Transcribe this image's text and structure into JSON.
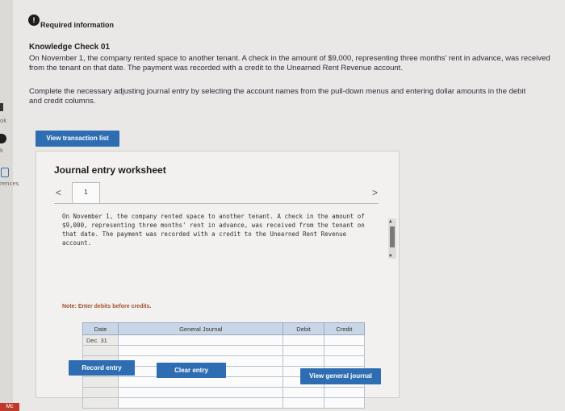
{
  "sidebar": {
    "labels": [
      "ok",
      "k",
      "rences"
    ],
    "badge": "Mc"
  },
  "header": {
    "badge": "!",
    "required": "Required information",
    "check_title": "Knowledge Check 01"
  },
  "content": {
    "intro": "On November 1, the company rented space to another tenant. A check in the amount of $9,000, representing three months' rent in advance, was received from the tenant on that date. The payment was recorded with a credit to the Unearned Rent Revenue account.",
    "instruction": "Complete the necessary adjusting journal entry by selecting the account names from the pull-down menus and entering dollar amounts in the debit and credit columns.",
    "view_transactions": "View transaction list"
  },
  "worksheet": {
    "title": "Journal entry worksheet",
    "prev": "<",
    "next": ">",
    "tab": "1",
    "description": "On November 1, the company rented space to another tenant. A check in the amount of $9,000, representing three months' rent in advance, was received from the tenant on that date. The payment was recorded with a credit to the Unearned Rent Revenue account.",
    "note": "Note: Enter debits before credits.",
    "columns": {
      "date": "Date",
      "general_journal": "General Journal",
      "debit": "Debit",
      "credit": "Credit"
    },
    "rows": [
      {
        "date": "Dec. 31",
        "account": "",
        "debit": "",
        "credit": ""
      },
      {
        "date": "",
        "account": "",
        "debit": "",
        "credit": ""
      },
      {
        "date": "",
        "account": "",
        "debit": "",
        "credit": ""
      },
      {
        "date": "",
        "account": "",
        "debit": "",
        "credit": ""
      },
      {
        "date": "",
        "account": "",
        "debit": "",
        "credit": ""
      },
      {
        "date": "",
        "account": "",
        "debit": "",
        "credit": ""
      },
      {
        "date": "",
        "account": "",
        "debit": "",
        "credit": ""
      }
    ],
    "record_entry": "Record entry",
    "clear_entry": "Clear entry",
    "view_general_journal": "View general journal"
  },
  "colors": {
    "button_blue": "#2f6db3",
    "header_blue": "#c9d6e8",
    "note": "#a0522d"
  }
}
